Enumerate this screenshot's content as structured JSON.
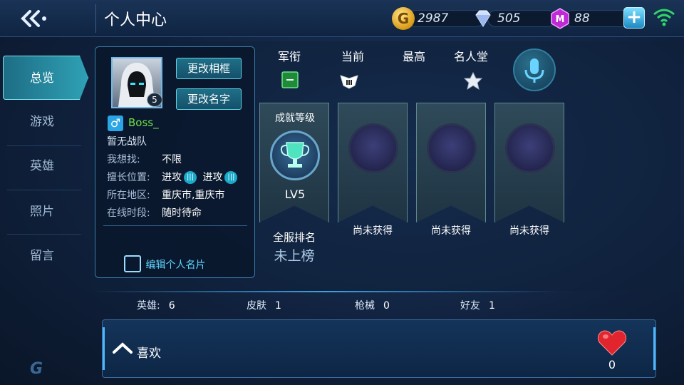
{
  "header": {
    "title": "个人中心",
    "currencies": [
      {
        "icon": "gold-coin-icon",
        "value": "2987"
      },
      {
        "icon": "diamond-icon",
        "value": "505"
      },
      {
        "icon": "purple-gem-icon",
        "value": "88"
      }
    ]
  },
  "sidebar": {
    "items": [
      {
        "label": "总览",
        "active": true
      },
      {
        "label": "游戏",
        "active": false
      },
      {
        "label": "英雄",
        "active": false
      },
      {
        "label": "照片",
        "active": false
      },
      {
        "label": "留言",
        "active": false
      }
    ]
  },
  "profile": {
    "avatar_level": "5",
    "change_frame_label": "更改相框",
    "change_name_label": "更改名字",
    "name": "Boss_",
    "team": "暂无战队",
    "looking_for_label": "我想找:",
    "looking_for_value": "不限",
    "position_label": "擅长位置:",
    "position_values": [
      "进攻",
      "进攻"
    ],
    "region_label": "所在地区:",
    "region_value": "重庆市,重庆市",
    "online_label": "在线时段:",
    "online_value": "随时待命",
    "edit_card_label": "编辑个人名片"
  },
  "ranks": {
    "headers": [
      "军衔",
      "当前",
      "最高",
      "名人堂"
    ]
  },
  "achievements": {
    "level_title": "成就等级",
    "level_value": "LV5",
    "unearned_label": "尚未获得",
    "server_rank_label": "全服排名",
    "server_rank_value": "未上榜"
  },
  "stats": [
    {
      "label": "英雄:",
      "value": "6"
    },
    {
      "label": "皮肤",
      "value": "1"
    },
    {
      "label": "枪械",
      "value": "0"
    },
    {
      "label": "好友",
      "value": "1"
    }
  ],
  "likes": {
    "label": "喜欢",
    "count": "0"
  },
  "colors": {
    "accent": "#2fa1b5",
    "player_name": "#6fe04a",
    "heart": "#e0252f"
  }
}
